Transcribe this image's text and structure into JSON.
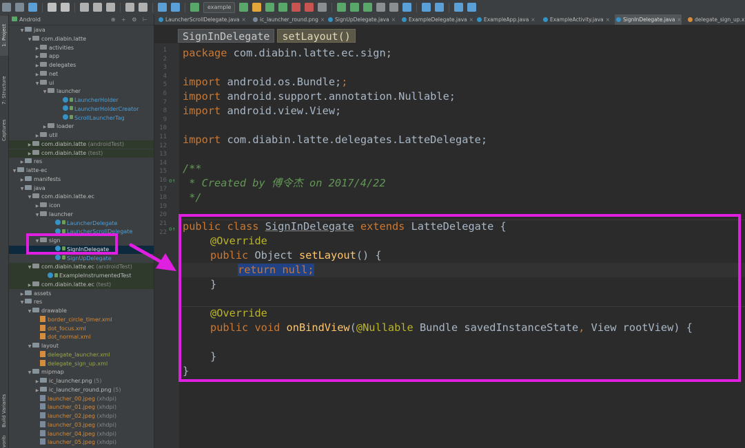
{
  "toolbar": {
    "run_config": "example"
  },
  "left_strip": {
    "tabs": [
      "1: Project",
      "7: Structure",
      "Captures",
      "Build Variants",
      "Favorites"
    ]
  },
  "project": {
    "view_mode": "Android",
    "tree": [
      {
        "label": "java",
        "indent": 1,
        "arrow": "▼",
        "icon": "folder"
      },
      {
        "label": "com.diabin.latte",
        "indent": 2,
        "arrow": "▼",
        "icon": "pkg"
      },
      {
        "label": "activities",
        "indent": 3,
        "arrow": "▶",
        "icon": "pkg"
      },
      {
        "label": "app",
        "indent": 3,
        "arrow": "▶",
        "icon": "pkg"
      },
      {
        "label": "delegates",
        "indent": 3,
        "arrow": "▶",
        "icon": "pkg"
      },
      {
        "label": "net",
        "indent": 3,
        "arrow": "▶",
        "icon": "pkg"
      },
      {
        "label": "ui",
        "indent": 3,
        "arrow": "▼",
        "icon": "pkg"
      },
      {
        "label": "launcher",
        "indent": 4,
        "arrow": "▼",
        "icon": "pkg"
      },
      {
        "label": "LauncherHolder",
        "indent": 6,
        "arrow": "",
        "icon": "class",
        "color": "blue"
      },
      {
        "label": "LauncherHolderCreator",
        "indent": 6,
        "arrow": "",
        "icon": "class",
        "color": "blue"
      },
      {
        "label": "ScrollLauncherTag",
        "indent": 6,
        "arrow": "",
        "icon": "class",
        "color": "blue"
      },
      {
        "label": "loader",
        "indent": 4,
        "arrow": "▶",
        "icon": "pkg"
      },
      {
        "label": "util",
        "indent": 3,
        "arrow": "▶",
        "icon": "pkg"
      },
      {
        "label": "com.diabin.latte",
        "suffix": " (androidTest)",
        "indent": 2,
        "arrow": "▶",
        "icon": "pkg",
        "bg": "test"
      },
      {
        "label": "com.diabin.latte",
        "suffix": " (test)",
        "indent": 2,
        "arrow": "▶",
        "icon": "pkg",
        "bg": "test"
      },
      {
        "label": "res",
        "indent": 1,
        "arrow": "▶",
        "icon": "folder"
      },
      {
        "label": "latte-ec",
        "indent": 0,
        "arrow": "▼",
        "icon": "folder"
      },
      {
        "label": "manifests",
        "indent": 1,
        "arrow": "▶",
        "icon": "folder"
      },
      {
        "label": "java",
        "indent": 1,
        "arrow": "▼",
        "icon": "folder"
      },
      {
        "label": "com.diabin.latte.ec",
        "indent": 2,
        "arrow": "▼",
        "icon": "pkg"
      },
      {
        "label": "icon",
        "indent": 3,
        "arrow": "▶",
        "icon": "pkg"
      },
      {
        "label": "launcher",
        "indent": 3,
        "arrow": "▼",
        "icon": "pkg"
      },
      {
        "label": "LauncherDelegate",
        "indent": 5,
        "arrow": "",
        "icon": "class",
        "color": "blue"
      },
      {
        "label": "LauncherScrollDelegate",
        "indent": 5,
        "arrow": "",
        "icon": "class",
        "color": "blue"
      },
      {
        "label": "sign",
        "indent": 3,
        "arrow": "▼",
        "icon": "pkg"
      },
      {
        "label": "SignInDelegate",
        "indent": 5,
        "arrow": "",
        "icon": "class",
        "sel": true
      },
      {
        "label": "SignUpDelegate",
        "indent": 5,
        "arrow": "",
        "icon": "class",
        "color": "blue"
      },
      {
        "label": "com.diabin.latte.ec",
        "suffix": " (androidTest)",
        "indent": 2,
        "arrow": "▼",
        "icon": "pkg",
        "bg": "test"
      },
      {
        "label": "ExampleInstrumentedTest",
        "indent": 4,
        "arrow": "",
        "icon": "class",
        "bg": "test"
      },
      {
        "label": "com.diabin.latte.ec",
        "suffix": " (test)",
        "indent": 2,
        "arrow": "▶",
        "icon": "pkg",
        "bg": "test"
      },
      {
        "label": "assets",
        "indent": 1,
        "arrow": "▶",
        "icon": "folder"
      },
      {
        "label": "res",
        "indent": 1,
        "arrow": "▼",
        "icon": "folder"
      },
      {
        "label": "drawable",
        "indent": 2,
        "arrow": "▼",
        "icon": "folder"
      },
      {
        "label": "border_circle_timer.xml",
        "indent": 3,
        "arrow": "",
        "icon": "xml",
        "color": "orange"
      },
      {
        "label": "dot_focus.xml",
        "indent": 3,
        "arrow": "",
        "icon": "xml",
        "color": "orange"
      },
      {
        "label": "dot_normal.xml",
        "indent": 3,
        "arrow": "",
        "icon": "xml",
        "color": "orange"
      },
      {
        "label": "layout",
        "indent": 2,
        "arrow": "▼",
        "icon": "folder"
      },
      {
        "label": "delegate_launcher.xml",
        "indent": 3,
        "arrow": "",
        "icon": "xml",
        "color": "green"
      },
      {
        "label": "delegate_sign_up.xml",
        "indent": 3,
        "arrow": "",
        "icon": "xml",
        "color": "green"
      },
      {
        "label": "mipmap",
        "indent": 2,
        "arrow": "▼",
        "icon": "folder"
      },
      {
        "label": "ic_launcher.png",
        "suffix": " (5)",
        "indent": 3,
        "arrow": "▶",
        "icon": "folder"
      },
      {
        "label": "ic_launcher_round.png",
        "suffix": " (5)",
        "indent": 3,
        "arrow": "▶",
        "icon": "folder"
      },
      {
        "label": "launcher_00.jpeg",
        "suffix": " (xhdpi)",
        "indent": 3,
        "arrow": "",
        "icon": "img",
        "color": "orange"
      },
      {
        "label": "launcher_01.jpeg",
        "suffix": " (xhdpi)",
        "indent": 3,
        "arrow": "",
        "icon": "img",
        "color": "orange"
      },
      {
        "label": "launcher_02.jpeg",
        "suffix": " (xhdpi)",
        "indent": 3,
        "arrow": "",
        "icon": "img",
        "color": "orange"
      },
      {
        "label": "launcher_03.jpeg",
        "suffix": " (xhdpi)",
        "indent": 3,
        "arrow": "",
        "icon": "img",
        "color": "orange"
      },
      {
        "label": "launcher_04.jpeg",
        "suffix": " (xhdpi)",
        "indent": 3,
        "arrow": "",
        "icon": "img",
        "color": "orange"
      },
      {
        "label": "launcher_05.jpeg",
        "suffix": " (xhdpi)",
        "indent": 3,
        "arrow": "",
        "icon": "img",
        "color": "orange"
      }
    ]
  },
  "tabs": [
    {
      "label": "LauncherScrollDelegate.java",
      "icon": "class"
    },
    {
      "label": "ic_launcher_round.png",
      "icon": "image"
    },
    {
      "label": "SignUpDelegate.java",
      "icon": "class"
    },
    {
      "label": "ExampleDelegate.java",
      "icon": "class"
    },
    {
      "label": "ExampleApp.java",
      "icon": "class"
    },
    {
      "label": "ExampleActivity.java",
      "icon": "class"
    },
    {
      "label": "SignInDelegate.java",
      "icon": "class",
      "active": true
    },
    {
      "label": "delegate_sign_up.xml",
      "icon": "xml"
    }
  ],
  "breadcrumbs": [
    "SignInDelegate",
    "setLayout()"
  ],
  "editor": {
    "line_numbers": [
      "1",
      "2",
      "3",
      "4",
      "5",
      "6",
      "7",
      "8",
      "9",
      "10",
      "11",
      "12",
      "13",
      "14",
      "15",
      "16",
      "17",
      "18",
      "19",
      "20",
      "21",
      "22"
    ],
    "gutter_marks": [
      "o↑",
      "o↑"
    ],
    "code": {
      "l1_kw": "package",
      "l1_rest": " com.diabin.latte.ec.sign;",
      "import_kw": "import",
      "l3_rest": " android.os.Bundle;",
      "l4_rest": " android.support.annotation.Nullable;",
      "l5_rest": " android.view.View;",
      "l7_rest": " com.diabin.latte.delegates.LatteDelegate;",
      "l9": "/**",
      "l10": " * Created by 傅令杰 on 2017/4/22",
      "l11": " */",
      "l13_kw1": "public class",
      "l13_cls": "SignInDelegate",
      "l13_kw2": "extends",
      "l13_rest": " LatteDelegate {",
      "override": "@Override",
      "l15_kw": "public",
      "l15_type": " Object ",
      "l15_fn": "setLayout",
      "l15_rest": "() {",
      "l16_kw": "return null",
      "l16_rest": ";",
      "close_brace": "}",
      "l20_kw": "public void",
      "l20_fn": "onBindView",
      "l20_open": "(",
      "l20_ann": "@Nullable",
      "l20_p1": " Bundle savedInstanceState",
      "l20_comma": ",",
      "l20_p2": " View rootView) {"
    }
  },
  "colors": {
    "highlight_box": "#e020e0",
    "keyword": "#cc7832",
    "annotation": "#bbb529",
    "comment": "#629755",
    "method": "#ffc66d"
  }
}
